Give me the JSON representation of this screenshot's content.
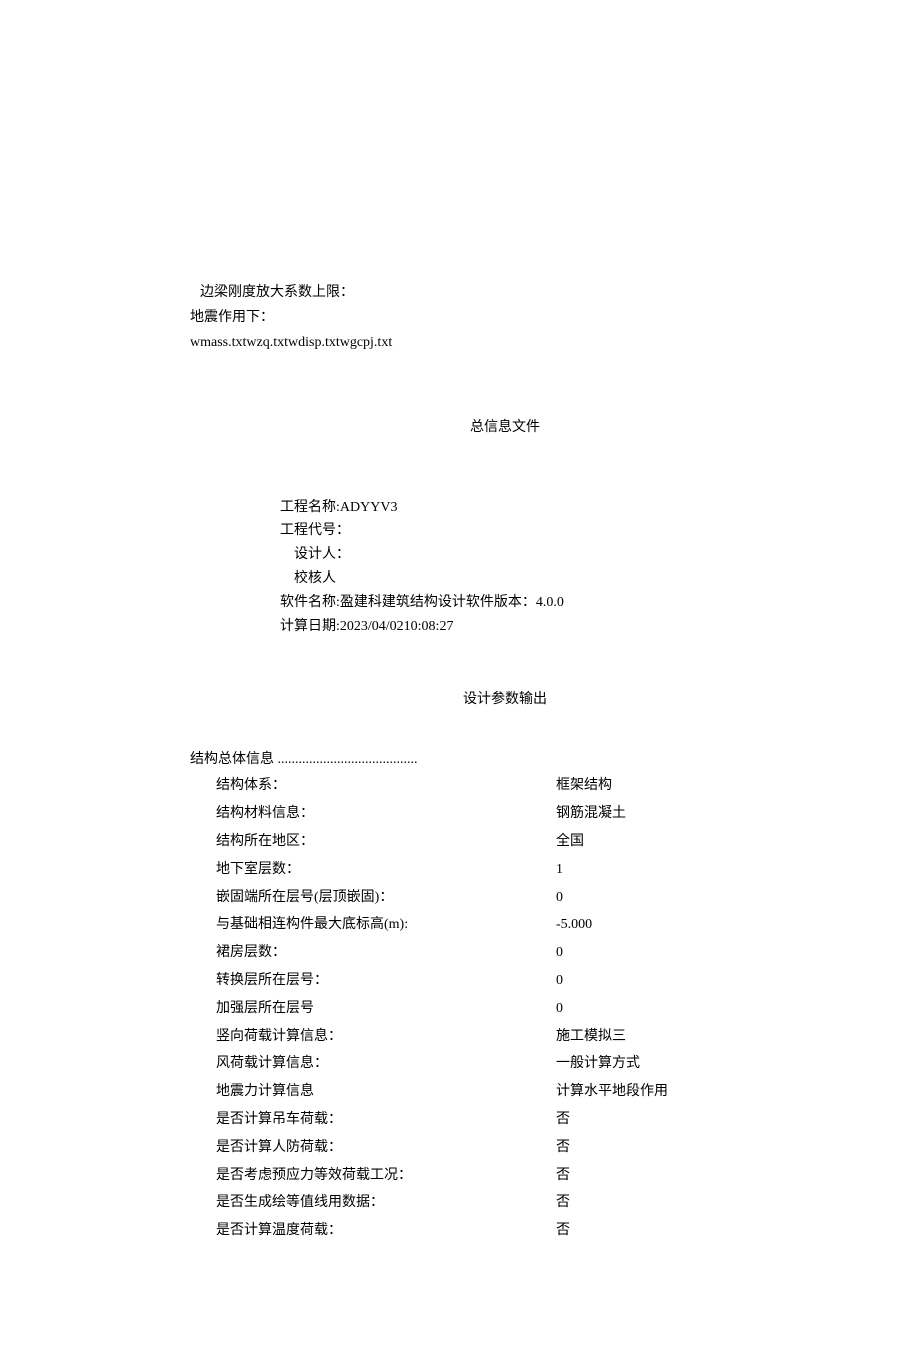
{
  "header": {
    "line1": "边梁刚度放大系数上限：",
    "line2": "地震作用下：",
    "line3": "wmass.txtwzq.txtwdisp.txtwgcpj.txt"
  },
  "title1": "总信息文件",
  "project_info": {
    "name_label": "工程名称:",
    "name_value": "ADYYV3",
    "code_label": "工程代号：",
    "designer_label": "设计人：",
    "checker_label": "校核人",
    "software_label": "软件名称:",
    "software_value": "盈建科建筑结构设计软件版本：4.0.0",
    "date_label": "计算日期:",
    "date_value": "2023/04/0210:08:27"
  },
  "title2": "设计参数输出",
  "section_header": "结构总体信息",
  "params": [
    {
      "label": "结构体系：",
      "value": "框架结构"
    },
    {
      "label": "结构材料信息：",
      "value": "钢筋混凝土"
    },
    {
      "label": "结构所在地区：",
      "value": "全国"
    },
    {
      "label": "地下室层数：",
      "value": "1"
    },
    {
      "label": "嵌固端所在层号(层顶嵌固)：",
      "value": "0"
    },
    {
      "label": "与基础相连构件最大底标高(m):",
      "value": "-5.000"
    },
    {
      "label": "裙房层数：",
      "value": "0"
    },
    {
      "label": "转换层所在层号：",
      "value": "0"
    },
    {
      "label": "加强层所在层号",
      "value": "0"
    },
    {
      "label": "竖向荷载计算信息：",
      "value": "施工模拟三"
    },
    {
      "label": "风荷载计算信息：",
      "value": "一般计算方式"
    },
    {
      "label": "地震力计算信息",
      "value": "计算水平地段作用"
    },
    {
      "label": "是否计算吊车荷载：",
      "value": "否"
    },
    {
      "label": "是否计算人防荷载：",
      "value": "否"
    },
    {
      "label": "是否考虑预应力等效荷载工况：",
      "value": "否"
    },
    {
      "label": "是否生成绘等值线用数据：",
      "value": "否"
    },
    {
      "label": "是否计算温度荷载：",
      "value": "否"
    }
  ]
}
